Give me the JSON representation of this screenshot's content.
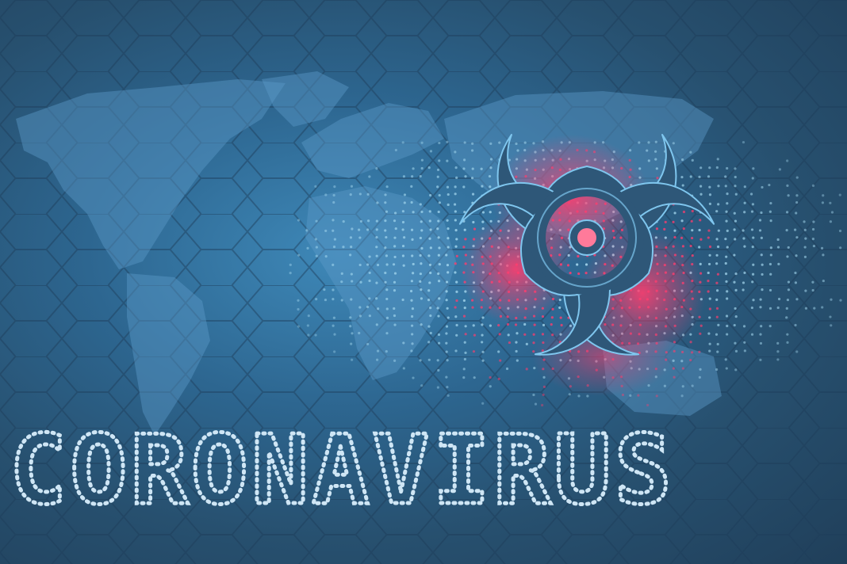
{
  "image": {
    "headline": "CORONAVIRUS",
    "symbol": "biohazard-icon",
    "background": "world-map-hexagon-pattern"
  },
  "colors": {
    "background_dark": "#203f5a",
    "background_mid": "#2d6690",
    "map_light": "#4d8fbd",
    "dots": "#a9dcf2",
    "glow": "#ff3d6e",
    "symbol_fill": "#2e5778",
    "symbol_outline": "#7fc6ee"
  }
}
